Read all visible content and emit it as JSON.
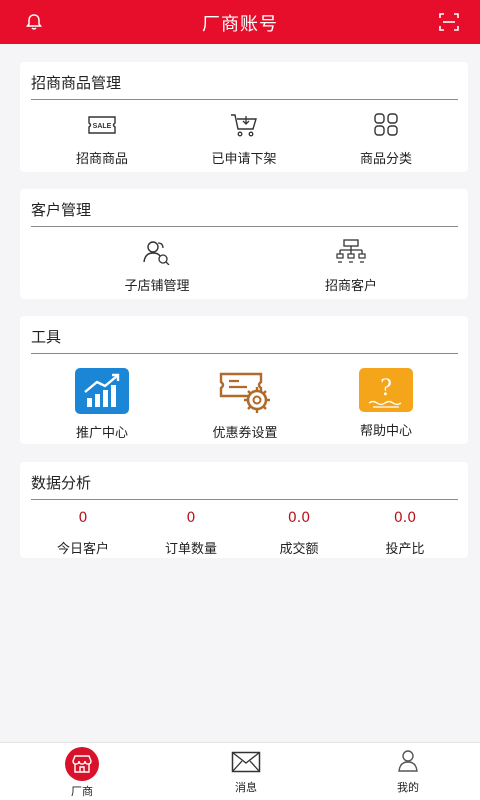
{
  "header": {
    "title": "厂商账号"
  },
  "sections": {
    "merchant": {
      "title": "招商商品管理",
      "items": [
        {
          "label": "招商商品",
          "icon": "sale-tag-icon"
        },
        {
          "label": "已申请下架",
          "icon": "cart-delist-icon"
        },
        {
          "label": "商品分类",
          "icon": "category-grid-icon"
        }
      ]
    },
    "customer": {
      "title": "客户管理",
      "items": [
        {
          "label": "子店铺管理",
          "icon": "sub-store-icon"
        },
        {
          "label": "招商客户",
          "icon": "org-chart-icon"
        }
      ]
    },
    "tools": {
      "title": "工具",
      "items": [
        {
          "label": "推广中心",
          "icon": "promotion-chart-icon"
        },
        {
          "label": "优惠券设置",
          "icon": "coupon-settings-icon"
        },
        {
          "label": "帮助中心",
          "icon": "help-icon"
        }
      ]
    },
    "analytics": {
      "title": "数据分析",
      "stats": [
        {
          "value": "0",
          "label": "今日客户"
        },
        {
          "value": "0",
          "label": "订单数量"
        },
        {
          "value": "0.0",
          "label": "成交额"
        },
        {
          "value": "0.0",
          "label": "投产比"
        }
      ]
    }
  },
  "tabbar": {
    "items": [
      {
        "label": "厂商",
        "icon": "store-icon",
        "active": true
      },
      {
        "label": "消息",
        "icon": "envelope-icon",
        "active": false
      },
      {
        "label": "我的",
        "icon": "user-icon",
        "active": false
      }
    ]
  },
  "colors": {
    "brand": "#e60e2a",
    "value": "#b5121b",
    "promo": "#1b86d6",
    "coupon": "#b06a2a",
    "help": "#f5a51a"
  }
}
